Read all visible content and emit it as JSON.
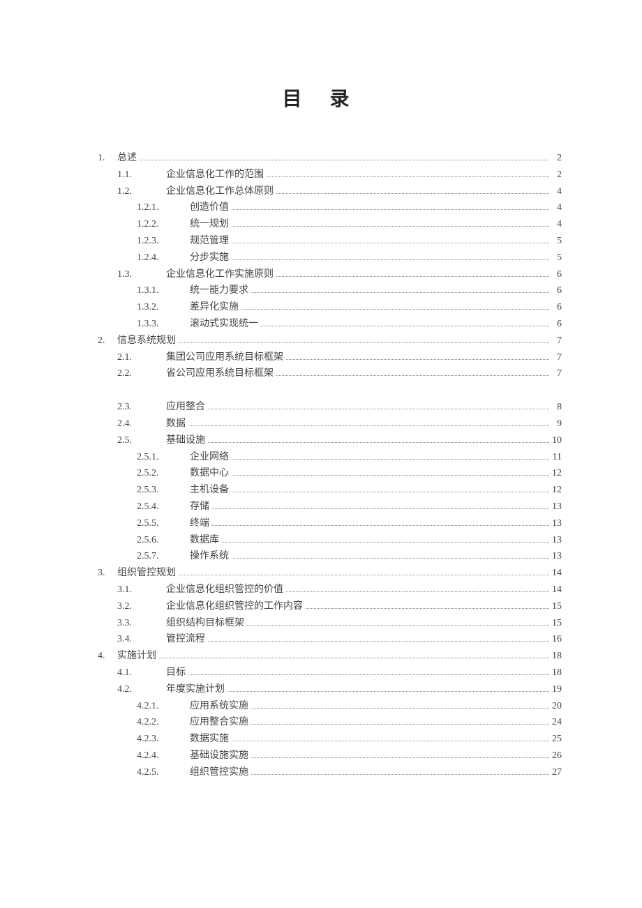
{
  "title": "目录",
  "entries": [
    {
      "level": 0,
      "num": "1.",
      "label": "总述",
      "page": "2"
    },
    {
      "level": 1,
      "num": "1.1.",
      "label": "企业信息化工作的范围",
      "page": "2"
    },
    {
      "level": 1,
      "num": "1.2.",
      "label": "企业信息化工作总体原则",
      "page": "4"
    },
    {
      "level": 2,
      "num": "1.2.1.",
      "label": "创造价值",
      "page": "4"
    },
    {
      "level": 2,
      "num": "1.2.2.",
      "label": "统一规划",
      "page": "4"
    },
    {
      "level": 2,
      "num": "1.2.3.",
      "label": "规范管理",
      "page": "5"
    },
    {
      "level": 2,
      "num": "1.2.4.",
      "label": "分步实施",
      "page": "5"
    },
    {
      "level": 1,
      "num": "1.3.",
      "label": "企业信息化工作实施原则",
      "page": "6"
    },
    {
      "level": 2,
      "num": "1.3.1.",
      "label": "统一能力要求",
      "page": "6"
    },
    {
      "level": 2,
      "num": "1.3.2.",
      "label": "差异化实施",
      "page": "6"
    },
    {
      "level": 2,
      "num": "1.3.3.",
      "label": "滚动式实现统一",
      "page": "6"
    },
    {
      "level": 0,
      "num": "2.",
      "label": "信息系统规划",
      "page": "7"
    },
    {
      "level": 1,
      "num": "2.1.",
      "label": "集团公司应用系统目标框架",
      "page": "7"
    },
    {
      "level": 1,
      "num": "2.2.",
      "label": "省公司应用系统目标框架",
      "page": "7"
    },
    {
      "blank": true
    },
    {
      "level": 1,
      "num": "2.3.",
      "label": "应用整合",
      "page": "8"
    },
    {
      "level": 1,
      "num": "2.4.",
      "label": "数据",
      "page": "9"
    },
    {
      "level": 1,
      "num": "2.5.",
      "label": "基础设施",
      "page": "10"
    },
    {
      "level": 2,
      "num": "2.5.1.",
      "label": "企业网络",
      "page": "11"
    },
    {
      "level": 2,
      "num": "2.5.2.",
      "label": "数据中心",
      "page": "12"
    },
    {
      "level": 2,
      "num": "2.5.3.",
      "label": "主机设备",
      "page": "12"
    },
    {
      "level": 2,
      "num": "2.5.4.",
      "label": "存储",
      "page": "13"
    },
    {
      "level": 2,
      "num": "2.5.5.",
      "label": "终端",
      "page": "13"
    },
    {
      "level": 2,
      "num": "2.5.6.",
      "label": "数据库",
      "page": "13"
    },
    {
      "level": 2,
      "num": "2.5.7.",
      "label": "操作系统",
      "page": "13"
    },
    {
      "level": 0,
      "num": "3.",
      "label": "组织管控规划",
      "page": "14"
    },
    {
      "level": 1,
      "num": "3.1.",
      "label": "企业信息化组织管控的价值",
      "page": "14"
    },
    {
      "level": 1,
      "num": "3.2.",
      "label": "企业信息化组织管控的工作内容",
      "page": "15"
    },
    {
      "level": 1,
      "num": "3.3.",
      "label": "组织结构目标框架",
      "page": "15"
    },
    {
      "level": 1,
      "num": "3.4.",
      "label": "管控流程",
      "page": "16"
    },
    {
      "level": 0,
      "num": "4.",
      "label": "实施计划",
      "page": "18"
    },
    {
      "level": 1,
      "num": "4.1.",
      "label": "目标",
      "page": "18"
    },
    {
      "level": 1,
      "num": "4.2.",
      "label": "年度实施计划",
      "page": "19"
    },
    {
      "level": 2,
      "num": "4.2.1.",
      "label": "应用系统实施",
      "page": "20"
    },
    {
      "level": 2,
      "num": "4.2.2.",
      "label": "应用整合实施",
      "page": "24"
    },
    {
      "level": 2,
      "num": "4.2.3.",
      "label": "数据实施",
      "page": "25"
    },
    {
      "level": 2,
      "num": "4.2.4.",
      "label": "基础设施实施",
      "page": "26"
    },
    {
      "level": 2,
      "num": "4.2.5.",
      "label": "组织管控实施",
      "page": "27"
    }
  ]
}
